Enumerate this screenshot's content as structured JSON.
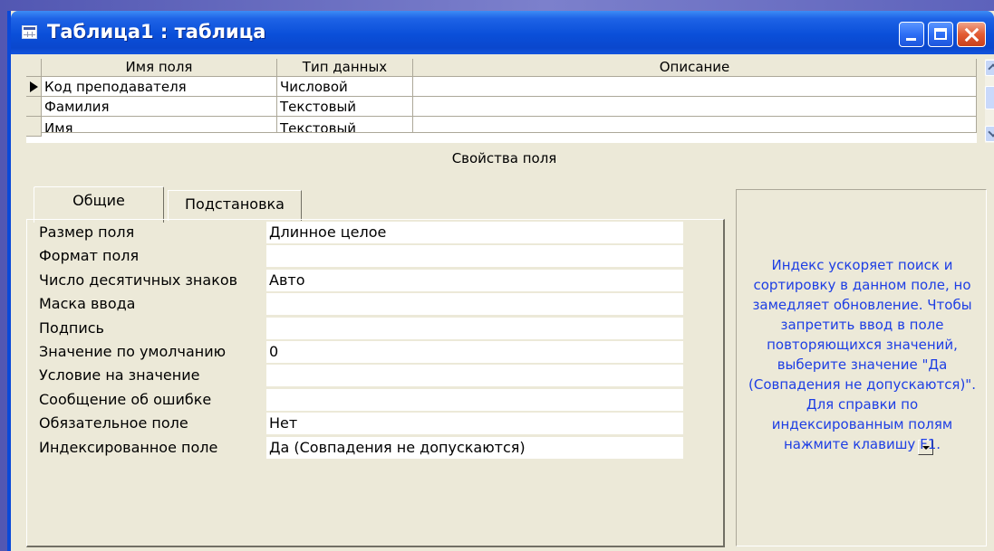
{
  "window": {
    "title": "Таблица1 : таблица"
  },
  "grid": {
    "headers": [
      "Имя поля",
      "Тип данных",
      "Описание"
    ],
    "rows": [
      {
        "name": "Код преподавателя",
        "type": "Числовой",
        "description": ""
      },
      {
        "name": "Фамилия",
        "type": "Текстовый",
        "description": ""
      },
      {
        "name": "Имя",
        "type": "Текстовый",
        "description": ""
      }
    ]
  },
  "properties": {
    "caption": "Свойства поля",
    "tabs": [
      "Общие",
      "Подстановка"
    ],
    "active_tab": "Общие",
    "fields": [
      {
        "label": "Размер поля",
        "value": "Длинное целое"
      },
      {
        "label": "Формат поля",
        "value": ""
      },
      {
        "label": "Число десятичных знаков",
        "value": "Авто"
      },
      {
        "label": "Маска ввода",
        "value": ""
      },
      {
        "label": "Подпись",
        "value": ""
      },
      {
        "label": "Значение по умолчанию",
        "value": "0"
      },
      {
        "label": "Условие на значение",
        "value": ""
      },
      {
        "label": "Сообщение об ошибке",
        "value": ""
      },
      {
        "label": "Обязательное поле",
        "value": "Нет"
      },
      {
        "label": "Индексированное поле",
        "value": "Да (Совпадения не допускаются)"
      }
    ],
    "help_text": "Индекс ускоряет поиск и сортировку в данном поле, но замедляет обновление. Чтобы запретить ввод в поле повторяющихся значений, выберите значение \"Да (Совпадения не допускаются)\". Для справки по индексированным полям нажмите клавишу F1."
  },
  "colors": {
    "titlebar": "#0a4fd9",
    "window_bg": "#ece9d8",
    "help_text": "#1d3ee4",
    "desktop": "#6f73c4"
  },
  "icons": [
    "table-icon",
    "minimize-icon",
    "maximize-icon",
    "close-icon",
    "row-pointer-icon",
    "scroll-up-icon",
    "scroll-down-icon",
    "dropdown-arrow-icon"
  ]
}
